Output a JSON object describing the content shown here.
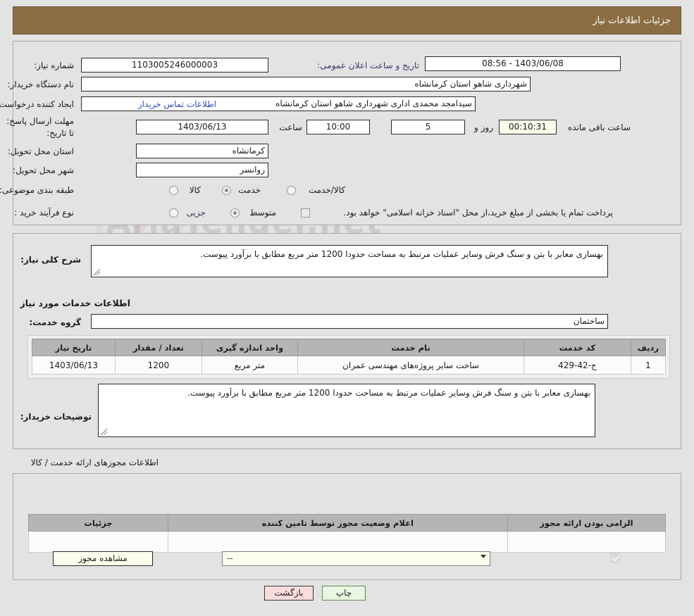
{
  "header": {
    "title": "جزئیات اطلاعات نیاز"
  },
  "watermark": {
    "text": "AriaTender.net"
  },
  "top": {
    "need_number_label": "شماره نیاز:",
    "need_number_value": "1103005246000003",
    "announce_label": "تاریخ و ساعت اعلان عمومی:",
    "announce_value": "1403/06/08 - 08:56",
    "buyer_org_label": "نام دستگاه خریدار:",
    "buyer_org_value": "شهرداری شاهو استان کرمانشاه",
    "requester_label": "ایجاد کننده درخواست:",
    "requester_value": "سیدامجد محمدی اداری شهرداری شاهو استان کرمانشاه",
    "contact_link": "اطلاعات تماس خریدار",
    "deadline_label": "مهلت ارسال پاسخ: تا تاریخ:",
    "deadline_date": "1403/06/13",
    "hour_label": "ساعت",
    "deadline_time": "10:00",
    "days_value": "5",
    "days_label": "روز و",
    "countdown_value": "00:10:31",
    "remaining_label": "ساعت باقی مانده",
    "province_label": "استان محل تحویل:",
    "province_value": "کرمانشاه",
    "city_label": "شهر محل تحویل:",
    "city_value": "روانسر",
    "category_label": "طبقه بندی موضوعی:",
    "category_options": [
      "کالا",
      "خدمت",
      "کالا/خدمت"
    ],
    "category_selected": "خدمت",
    "process_label": "نوع فرآیند خرید :",
    "process_options": [
      "جزیی",
      "متوسط"
    ],
    "process_selected": "متوسط",
    "treasury_note": "پرداخت تمام یا بخشی از مبلغ خرید،از محل \"اسناد خزانه اسلامی\" خواهد بود."
  },
  "mid": {
    "summary_label": "شرح کلی نیاز:",
    "summary_value": "بهسازی معابر با بتن و سنگ فرش وسایر عملیات مرتبط به مساحت حدودا 1200 متر مربع مطابق با برآورد پیوست.",
    "services_heading": "اطلاعات خدمات مورد نیاز",
    "service_group_label": "گروه خدمت:",
    "service_group_value": "ساختمان",
    "table": {
      "columns": [
        "ردیف",
        "کد خدمت",
        "نام خدمت",
        "واحد اندازه گیری",
        "تعداد / مقدار",
        "تاریخ نیاز"
      ],
      "rows": [
        [
          "1",
          "ج-42-429",
          "ساخت سایر پروژه‌های مهندسی عمران",
          "متر مربع",
          "1200",
          "1403/06/13"
        ]
      ]
    },
    "buyer_notes_label": "توضیحات خریدار:",
    "buyer_notes_value": "بهسازی معابر با بتن و سنگ فرش وسایر عملیات مرتبط به مساحت حدودا 1200 متر مربع مطابق با برآورد پیوست."
  },
  "bottom": {
    "section_caption": "اطلاعات مجوزهای ارائه خدمت / کالا",
    "table": {
      "columns": [
        "الزامی بودن ارائه مجوز",
        "اعلام وضعیت مجوز توسط تامین کننده",
        "جزئیات"
      ],
      "row": {
        "required_checked": true,
        "status_value": "--",
        "details_button": "مشاهده مجوز"
      }
    }
  },
  "footer": {
    "print_label": "چاپ",
    "back_label": "بازگشت"
  }
}
